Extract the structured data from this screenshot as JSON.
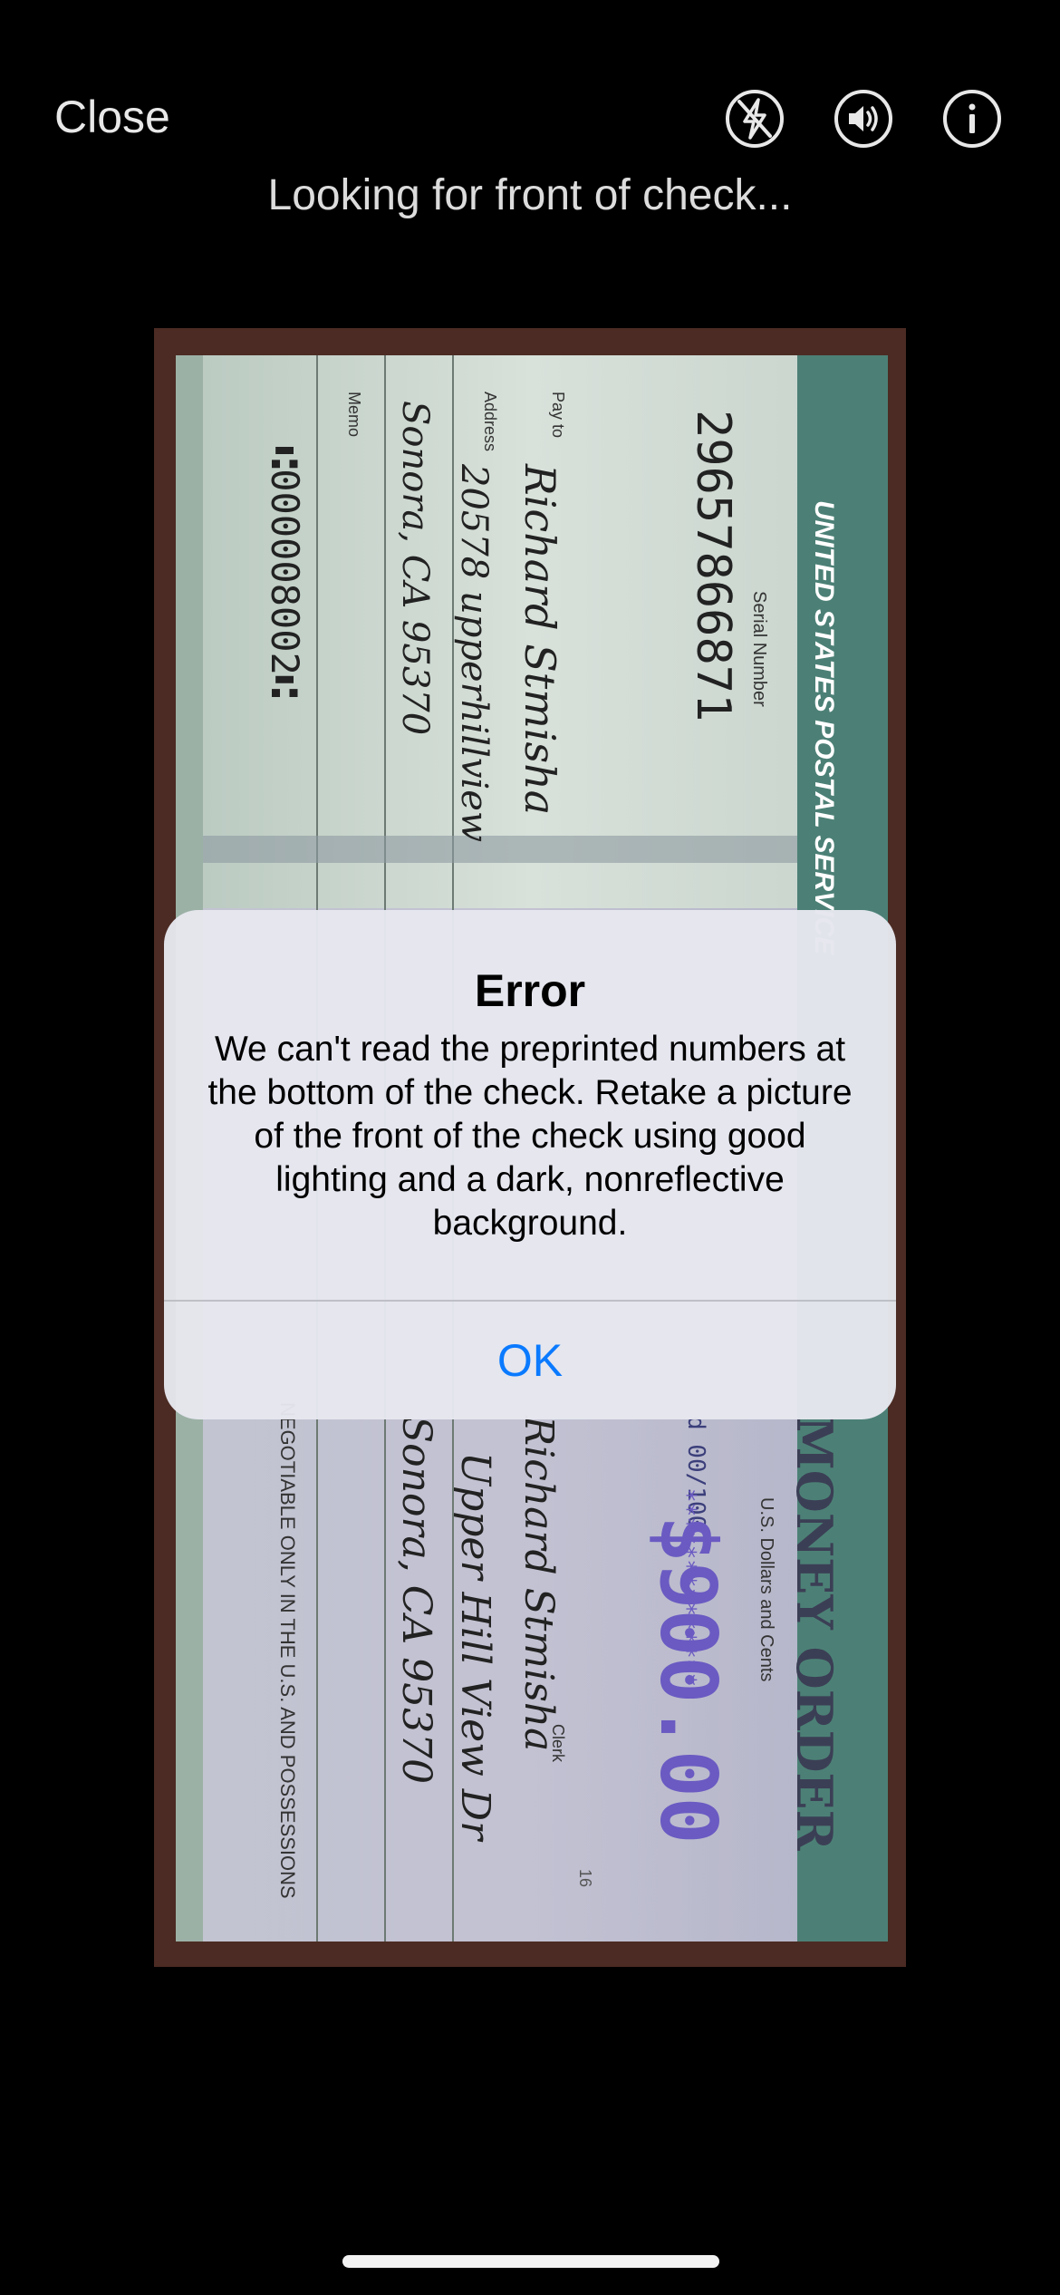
{
  "header": {
    "close_label": "Close",
    "status_text": "Looking for front of check...",
    "icons": [
      "flash-off-icon",
      "speaker-icon",
      "info-icon"
    ]
  },
  "check": {
    "issuer": "UNITED STATES POSTAL SERVICE",
    "serial_label": "Serial Number",
    "serial_number": "29657866871",
    "pay_to_label": "Pay to",
    "pay_to_value": "Richard Stmisha",
    "address_label": "Address",
    "address_line1": "20578 upperhillview",
    "address_line2": "Sonora, CA 95370",
    "memo_label": "Memo",
    "micr_line": "⑆000008002⑆",
    "money_order_label": "MONEY ORDER",
    "dollars_label": "U.S. Dollars and Cents",
    "amount_written": "d 00/100",
    "amount_numeric": "$900.00",
    "stars": "**************",
    "clerk_label": "Clerk",
    "negotiable_text": "NEGOTIABLE ONLY IN THE U.S. AND POSSESSIONS",
    "back_name": "Richard Stmisha",
    "back_address1": "Upper Hill View Dr",
    "back_address2": "Sonora, CA 95370",
    "small_number": "16"
  },
  "alert": {
    "title": "Error",
    "message": "We can't read the preprinted numbers at the bottom of the check. Retake a picture of the front of the check using good lighting and a dark, nonreflective background.",
    "ok_label": "OK"
  },
  "colors": {
    "accent": "#0a7aff",
    "background": "#000000"
  }
}
